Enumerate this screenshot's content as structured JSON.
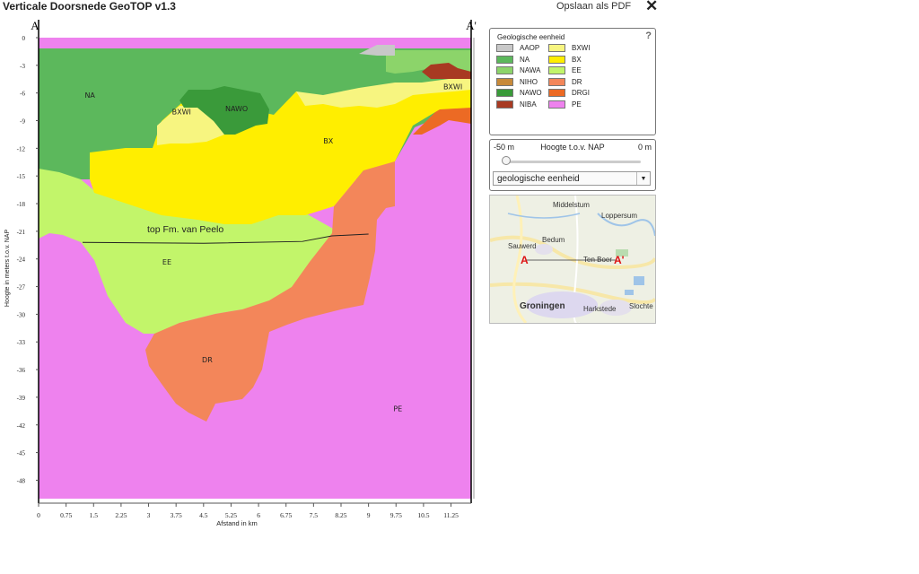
{
  "window": {
    "title": "Verticale Doorsnede GeoTOP v1.3",
    "pdf_label": "Opslaan als PDF",
    "close_icon": "close-icon"
  },
  "chart_data": {
    "type": "cross-section",
    "section_start_label": "A",
    "section_end_label": "A'",
    "xlabel": "Afstand in km",
    "ylabel": "Hoogte in meters t.o.v. NAP",
    "x_ticks": [
      "0",
      "0.75",
      "1.5",
      "2.25",
      "3",
      "3.75",
      "4.5",
      "5.25",
      "6",
      "6.75",
      "7.5",
      "8.25",
      "9",
      "9.75",
      "10.5",
      "11.25"
    ],
    "y_ticks": [
      "0",
      "-3",
      "-6",
      "-9",
      "-12",
      "-15",
      "-18",
      "-21",
      "-24",
      "-27",
      "-30",
      "-33",
      "-36",
      "-39",
      "-42",
      "-45",
      "-48"
    ],
    "xlim": [
      0,
      11.8
    ],
    "ylim": [
      -50,
      0
    ],
    "unit_labels": [
      {
        "text": "NA",
        "x": 1.4,
        "y": -6.5
      },
      {
        "text": "NAWO",
        "x": 5.4,
        "y": -8
      },
      {
        "text": "BXWI",
        "x": 3.9,
        "y": -8.3
      },
      {
        "text": "BXWI",
        "x": 11.3,
        "y": -5.6
      },
      {
        "text": "BX",
        "x": 7.9,
        "y": -11.5
      },
      {
        "text": "EE",
        "x": 3.5,
        "y": -24.6
      },
      {
        "text": "DR",
        "x": 4.6,
        "y": -35.2
      },
      {
        "text": "PE",
        "x": 9.8,
        "y": -40.5
      }
    ],
    "annotation": "top Fm. van Peelo",
    "series": [
      {
        "name": "top Fm. van Peelo",
        "points": [
          [
            1.2,
            -22.2
          ],
          [
            4.5,
            -22.3
          ],
          [
            7.2,
            -22.1
          ],
          [
            8.0,
            -21.5
          ],
          [
            9.0,
            -21.3
          ]
        ]
      }
    ],
    "units": [
      {
        "code": "AAOP",
        "color": "#c8c8c8"
      },
      {
        "code": "NA",
        "color": "#5cb85c"
      },
      {
        "code": "NAWA",
        "color": "#8cd46a"
      },
      {
        "code": "NIHO",
        "color": "#c88a3a"
      },
      {
        "code": "NAWO",
        "color": "#3a9a3a"
      },
      {
        "code": "NIBA",
        "color": "#a83a22"
      },
      {
        "code": "BXWI",
        "color": "#f7f580"
      },
      {
        "code": "BX",
        "color": "#ffee00"
      },
      {
        "code": "EE",
        "color": "#c2f56a"
      },
      {
        "code": "DR",
        "color": "#f3865a"
      },
      {
        "code": "DRGI",
        "color": "#ec6a24"
      },
      {
        "code": "PE",
        "color": "#ee82ee"
      }
    ]
  },
  "legend": {
    "title": "Geologische eenheid",
    "help_icon": "help-icon"
  },
  "height_control": {
    "min_label": "-50 m",
    "title": "Hoogte t.o.v. NAP",
    "max_label": "0 m",
    "value_m": -50,
    "select_value": "geologische eenheid"
  },
  "map": {
    "places": [
      "Middelstum",
      "Loppersum",
      "Sauwerd",
      "Bedum",
      "Ten Boer",
      "Groningen",
      "Harkstede",
      "Slochte"
    ],
    "marker_start": "A",
    "marker_end": "A'"
  }
}
